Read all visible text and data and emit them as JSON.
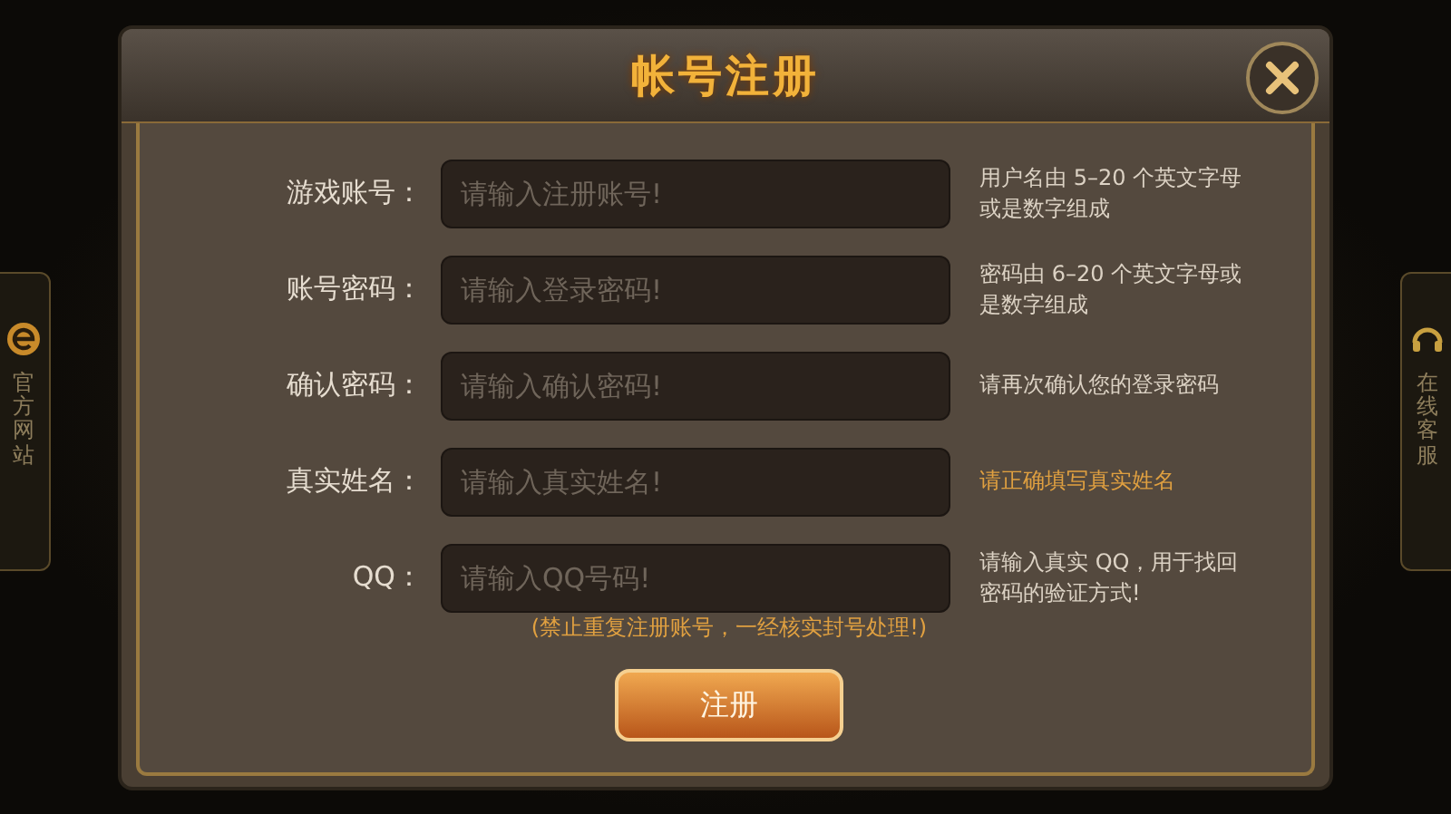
{
  "side_tabs": [
    {
      "kind": "website",
      "label": "官方网站"
    },
    {
      "kind": "support",
      "label": "在线客服"
    }
  ],
  "dialog": {
    "title": "帐号注册",
    "fields": [
      {
        "label": "游戏账号：",
        "placeholder": "请输入注册账号!",
        "hint": "用户名由 5–20 个英文字母或是数字组成",
        "hint_emphasis": false
      },
      {
        "label": "账号密码：",
        "placeholder": "请输入登录密码!",
        "hint": "密码由 6–20 个英文字母或是数字组成",
        "hint_emphasis": false
      },
      {
        "label": "确认密码：",
        "placeholder": "请输入确认密码!",
        "hint": "请再次确认您的登录密码",
        "hint_emphasis": false
      },
      {
        "label": "真实姓名：",
        "placeholder": "请输入真实姓名!",
        "hint": "请正确填写真实姓名",
        "hint_emphasis": true
      },
      {
        "label": "QQ：",
        "placeholder": "请输入QQ号码!",
        "hint": "请输入真实 QQ，用于找回密码的验证方式!",
        "hint_emphasis": false
      }
    ],
    "notice": "(禁止重复注册账号，一经核实封号处理!)",
    "submit": "注册"
  }
}
